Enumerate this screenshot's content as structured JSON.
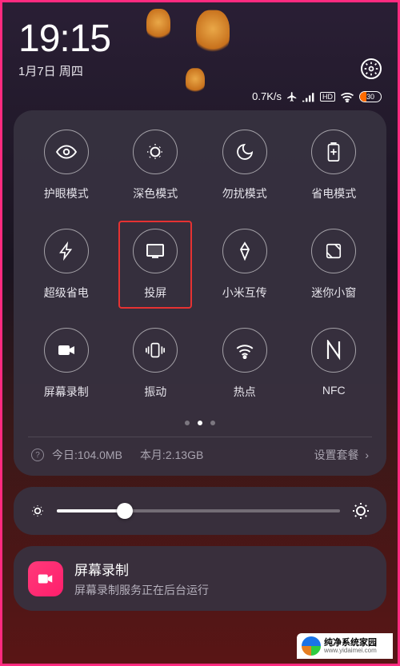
{
  "status": {
    "time": "19:15",
    "date": "1月7日 周四",
    "network_speed": "0.7K/s",
    "battery_percent": "30"
  },
  "qs": {
    "items": [
      {
        "label": "护眼模式",
        "icon": "eye"
      },
      {
        "label": "深色模式",
        "icon": "dark"
      },
      {
        "label": "勿扰模式",
        "icon": "moon"
      },
      {
        "label": "省电模式",
        "icon": "battery"
      },
      {
        "label": "超级省电",
        "icon": "bolt"
      },
      {
        "label": "投屏",
        "icon": "cast",
        "highlight": true
      },
      {
        "label": "小米互传",
        "icon": "share"
      },
      {
        "label": "迷你小窗",
        "icon": "window"
      },
      {
        "label": "屏幕录制",
        "icon": "camera"
      },
      {
        "label": "振动",
        "icon": "vibrate"
      },
      {
        "label": "热点",
        "icon": "hotspot"
      },
      {
        "label": "NFC",
        "icon": "nfc"
      }
    ]
  },
  "data_usage": {
    "today_label": "今日:",
    "today_value": "104.0MB",
    "month_label": "本月:",
    "month_value": "2.13GB",
    "plan_label": "设置套餐"
  },
  "notification": {
    "title": "屏幕录制",
    "subtitle": "屏幕录制服务正在后台运行"
  },
  "footer": {
    "brand": "纯净系统家园",
    "url": "www.yidaimei.com"
  }
}
